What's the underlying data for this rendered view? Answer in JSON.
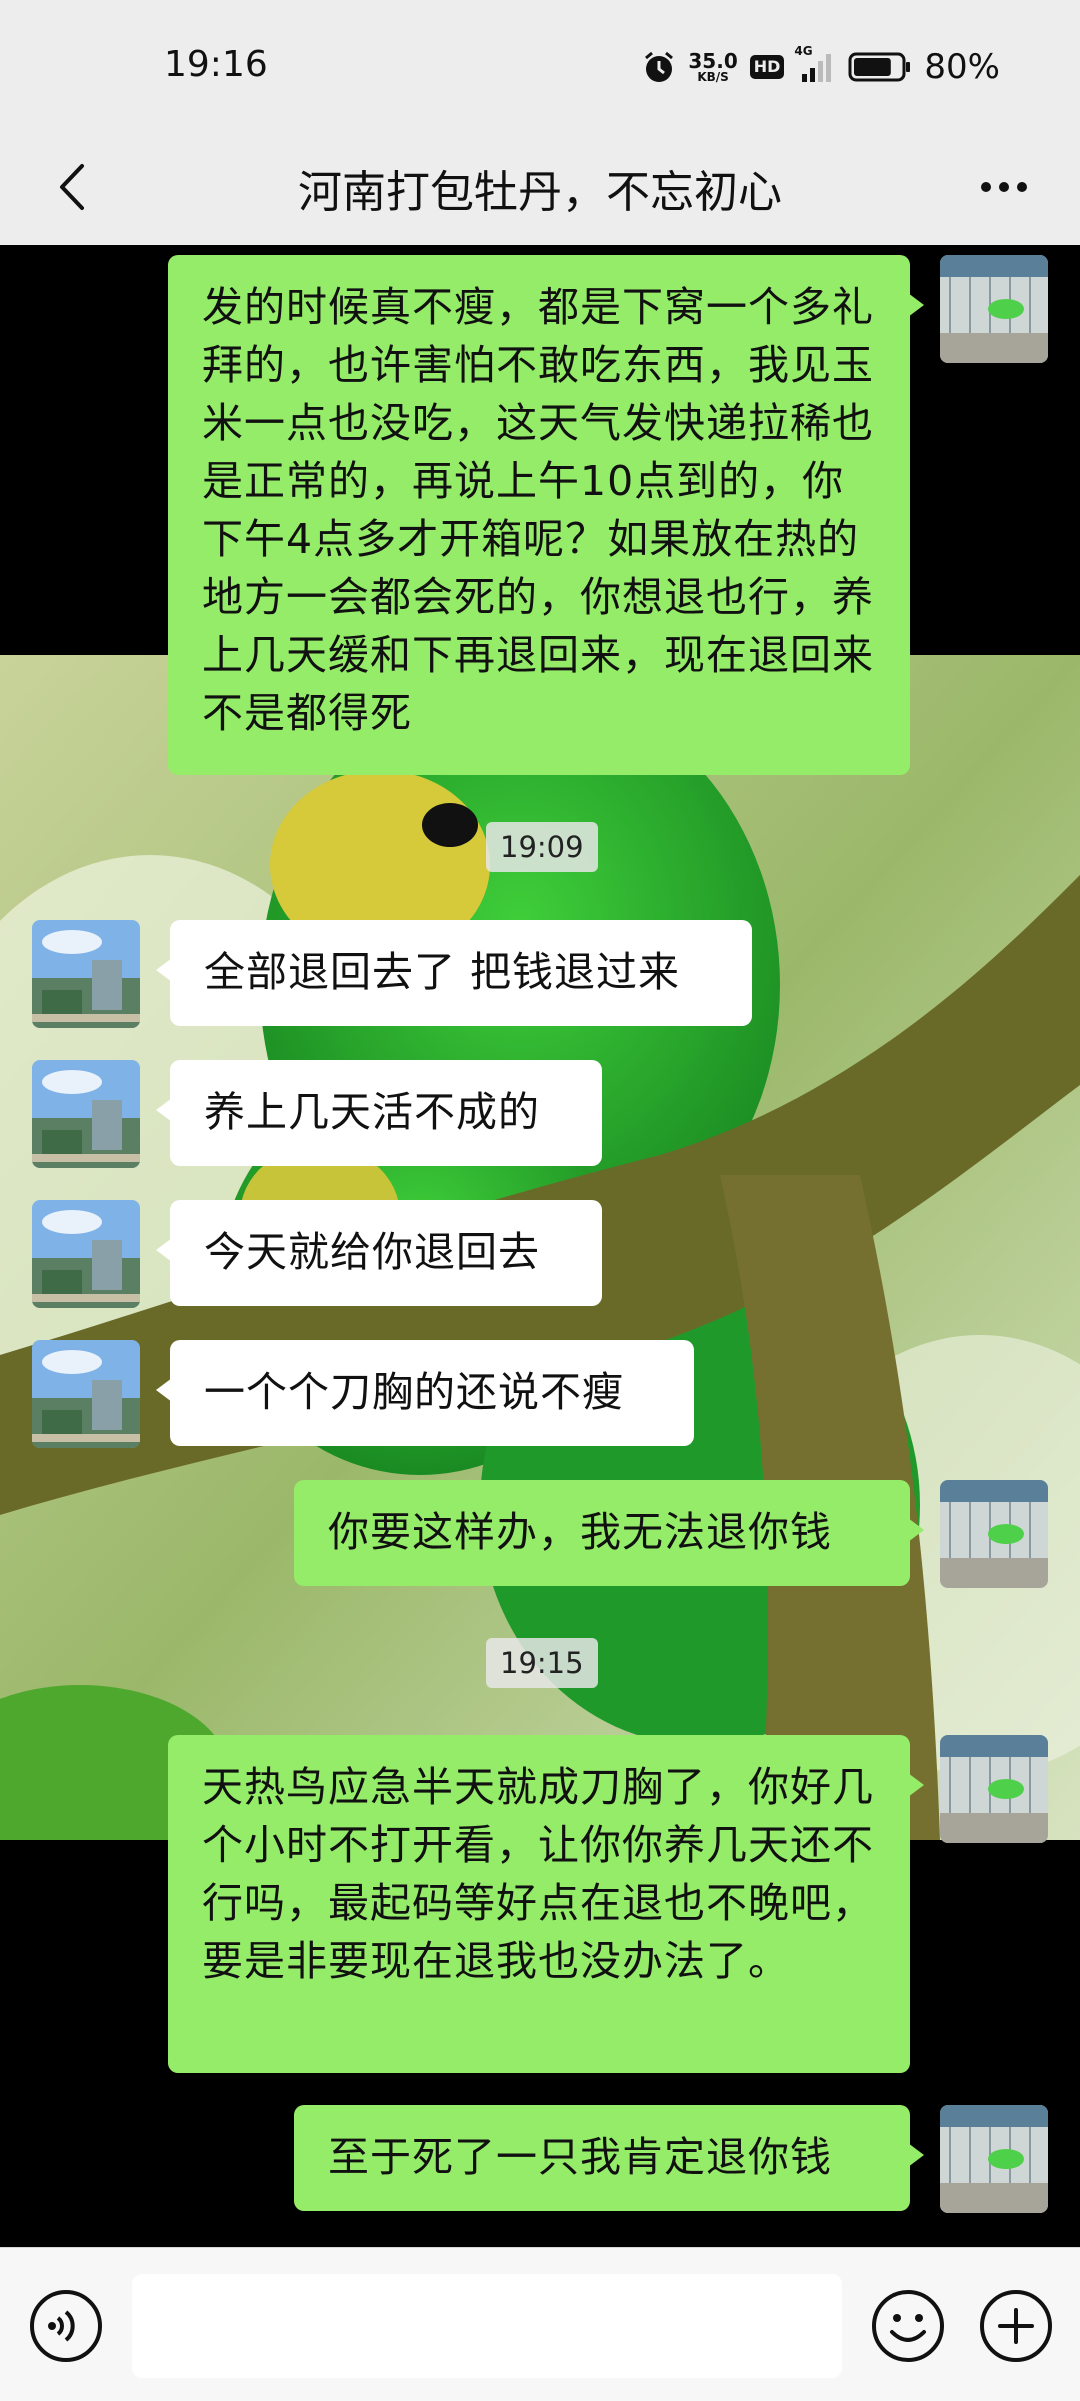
{
  "status_bar": {
    "time": "19:16",
    "net_speed_value": "35.0",
    "net_speed_unit": "KB/S",
    "hd_label": "HD",
    "network_type": "4G",
    "battery_percent": "80%",
    "battery_level": 0.8
  },
  "header": {
    "title": "河南打包牡丹，不忘初心",
    "back_icon": "chevron-left-icon",
    "more_icon": "more-dots-icon"
  },
  "messages": [
    {
      "sender": "me",
      "text": "发的时候真不瘦，都是下窝一个多礼拜的，也许害怕不敢吃东西，我见玉米一点也没吃，这天气发快递拉稀也是正常的，再说上午10点到的，你下午4点多才开箱呢？如果放在热的地方一会都会死的，你想退也行，养上几天缓和下再退回来，现在退回来不是都得死"
    },
    {
      "timestamp": "19:09"
    },
    {
      "sender": "other",
      "text": "全部退回去了 把钱退过来"
    },
    {
      "sender": "other",
      "text": "养上几天活不成的"
    },
    {
      "sender": "other",
      "text": "今天就给你退回去"
    },
    {
      "sender": "other",
      "text": "一个个刀胸的还说不瘦"
    },
    {
      "sender": "me",
      "text": "你要这样办，我无法退你钱"
    },
    {
      "timestamp": "19:15"
    },
    {
      "sender": "me",
      "text": "天热鸟应急半天就成刀胸了，你好几个小时不打开看，让你你养几天还不行吗，最起码等好点在退也不晚吧，要是非要现在退我也没办法了。"
    },
    {
      "sender": "me",
      "text": "至于死了一只我肯定退你钱"
    }
  ],
  "input_bar": {
    "voice_icon": "voice-icon",
    "placeholder": "",
    "emoji_icon": "emoji-icon",
    "plus_icon": "plus-icon"
  },
  "colors": {
    "my_bubble": "#95ec69",
    "other_bubble": "#ffffff",
    "bar_background": "#ededed"
  }
}
